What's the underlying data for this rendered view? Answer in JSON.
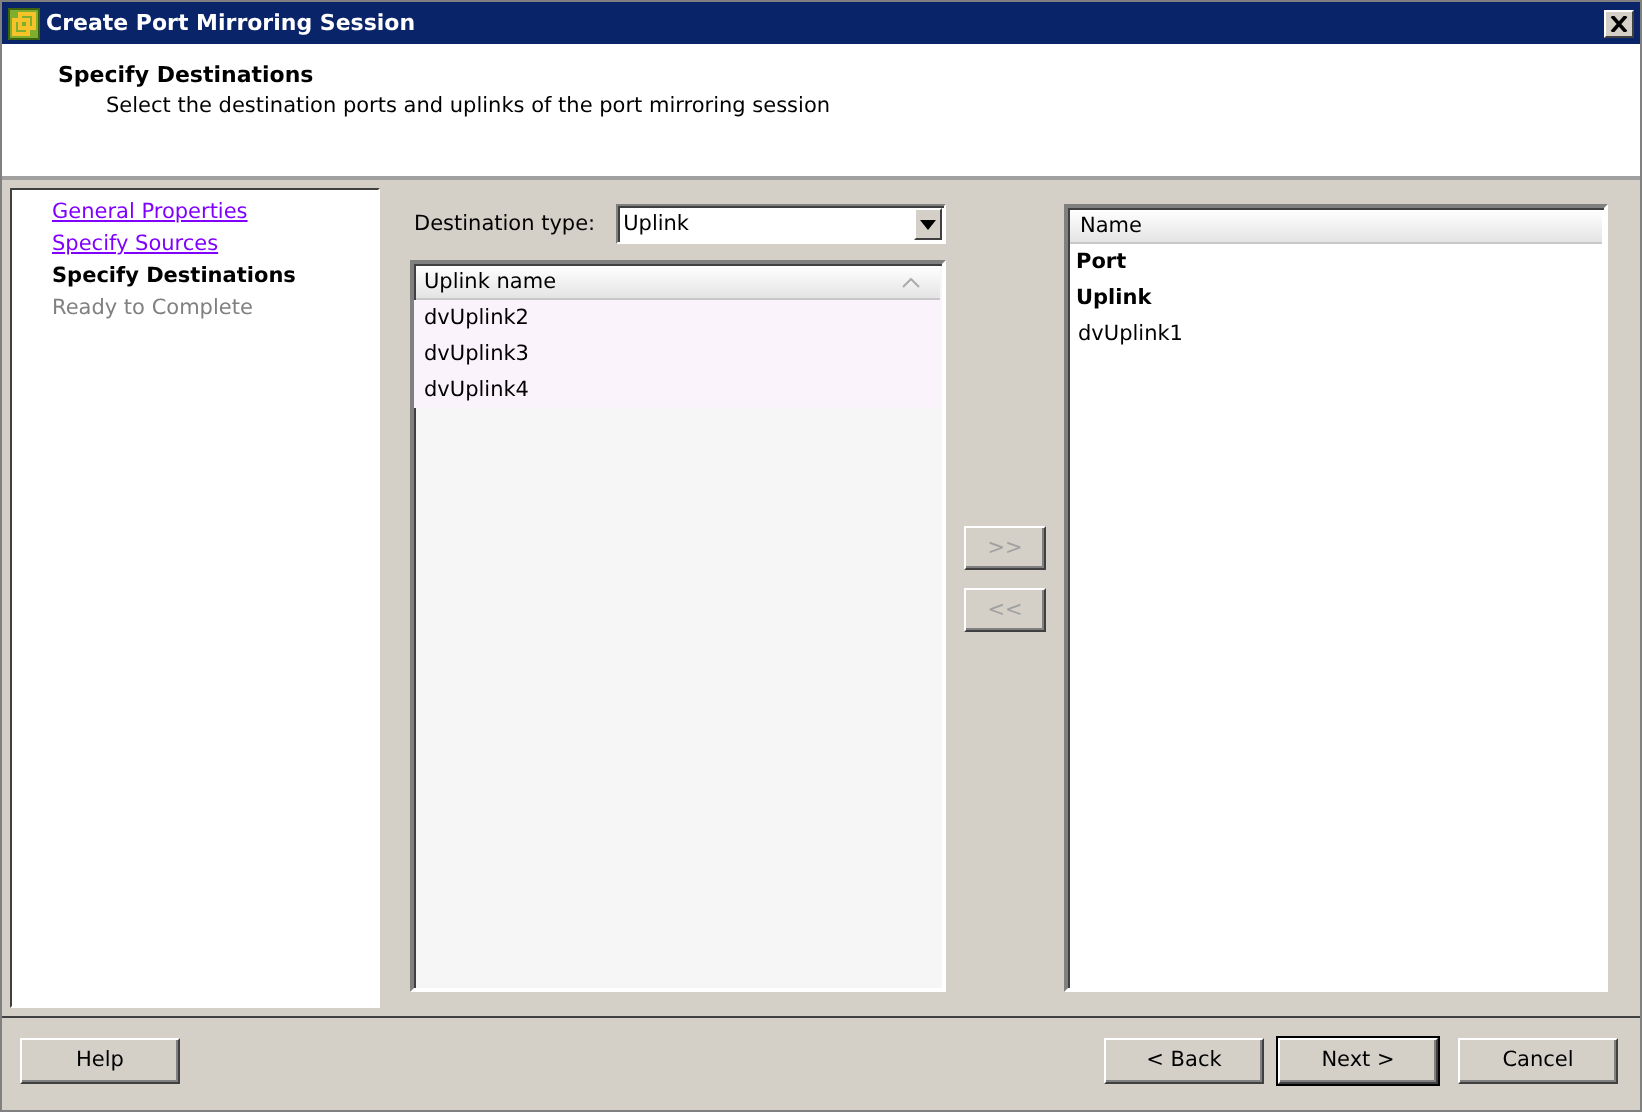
{
  "window": {
    "title": "Create Port Mirroring Session"
  },
  "header": {
    "title": "Specify Destinations",
    "subtitle": "Select the destination ports and uplinks of the port mirroring session"
  },
  "steps": [
    {
      "label": "General Properties",
      "kind": "visited"
    },
    {
      "label": "Specify Sources",
      "kind": "visited"
    },
    {
      "label": "Specify Destinations",
      "kind": "current"
    },
    {
      "label": "Ready to Complete",
      "kind": "pending"
    }
  ],
  "destination_type": {
    "label": "Destination type:",
    "value": "Uplink"
  },
  "available": {
    "column": "Uplink name",
    "rows": [
      "dvUplink2",
      "dvUplink3",
      "dvUplink4"
    ]
  },
  "move_buttons": [
    ">>",
    "<<"
  ],
  "selected_list": {
    "column": "Name",
    "groups": [
      {
        "label": "Port"
      },
      {
        "label": "Uplink",
        "children": [
          {
            "label": "dvUplink1"
          }
        ]
      }
    ]
  },
  "footer": {
    "left": [
      {
        "label": "Help",
        "default": false
      }
    ],
    "right": [
      {
        "label": "< Back",
        "default": false
      },
      {
        "label": "Next >",
        "default": true
      },
      {
        "label": "Cancel",
        "default": false
      }
    ]
  }
}
